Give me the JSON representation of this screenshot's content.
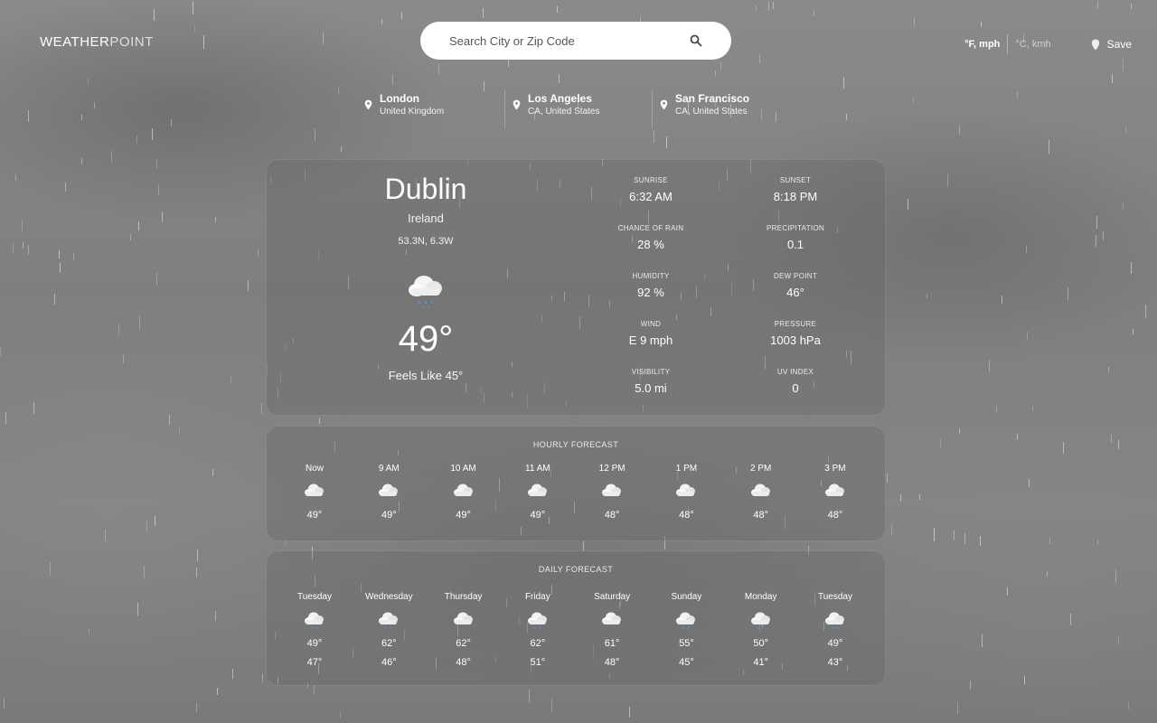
{
  "app": {
    "logo_bold": "WEATHER",
    "logo_light": "POINT"
  },
  "search": {
    "placeholder": "Search City or Zip Code",
    "icon": "search-icon"
  },
  "units": {
    "imperial": "°F, mph",
    "metric": "°C, kmh",
    "selected": "imperial"
  },
  "save_label": "Save",
  "saved_locations": [
    {
      "name": "London",
      "region": "United Kingdom"
    },
    {
      "name": "Los Angeles",
      "region": "CA, United States"
    },
    {
      "name": "San Francisco",
      "region": "CA, United States"
    }
  ],
  "current": {
    "city": "Dublin",
    "country": "Ireland",
    "coords": "53.3N, 6.3W",
    "icon": "cloud-rain-icon",
    "temperature": "49°",
    "feels_like": "Feels Like 45°",
    "stats": [
      {
        "label": "SUNRISE",
        "value": "6:32 AM"
      },
      {
        "label": "SUNSET",
        "value": "8:18 PM"
      },
      {
        "label": "CHANCE OF RAIN",
        "value": "28 %"
      },
      {
        "label": "PRECIPITATION",
        "value": "0.1"
      },
      {
        "label": "HUMIDITY",
        "value": "92 %"
      },
      {
        "label": "DEW POINT",
        "value": "46°"
      },
      {
        "label": "WIND",
        "value": "E 9 mph"
      },
      {
        "label": "PRESSURE",
        "value": "1003 hPa"
      },
      {
        "label": "VISIBILITY",
        "value": "5.0 mi"
      },
      {
        "label": "UV INDEX",
        "value": "0"
      }
    ]
  },
  "hourly": {
    "title": "HOURLY FORECAST",
    "items": [
      {
        "time": "Now",
        "temp": "49°",
        "icon": "cloud-icon"
      },
      {
        "time": "9 AM",
        "temp": "49°",
        "icon": "cloud-icon"
      },
      {
        "time": "10 AM",
        "temp": "49°",
        "icon": "cloud-icon"
      },
      {
        "time": "11 AM",
        "temp": "49°",
        "icon": "cloud-icon"
      },
      {
        "time": "12 PM",
        "temp": "48°",
        "icon": "cloud-icon"
      },
      {
        "time": "1 PM",
        "temp": "48°",
        "icon": "cloud-icon"
      },
      {
        "time": "2 PM",
        "temp": "48°",
        "icon": "cloud-icon"
      },
      {
        "time": "3 PM",
        "temp": "48°",
        "icon": "cloud-icon"
      }
    ]
  },
  "daily": {
    "title": "DAILY FORECAST",
    "items": [
      {
        "day": "Tuesday",
        "high": "49°",
        "low": "47°",
        "icon": "cloud-rain-icon"
      },
      {
        "day": "Wednesday",
        "high": "62°",
        "low": "46°",
        "icon": "cloud-rain-icon"
      },
      {
        "day": "Thursday",
        "high": "62°",
        "low": "48°",
        "icon": "cloud-icon"
      },
      {
        "day": "Friday",
        "high": "62°",
        "low": "51°",
        "icon": "cloud-rain-icon"
      },
      {
        "day": "Saturday",
        "high": "61°",
        "low": "48°",
        "icon": "cloud-icon"
      },
      {
        "day": "Sunday",
        "high": "55°",
        "low": "45°",
        "icon": "cloud-rain-icon"
      },
      {
        "day": "Monday",
        "high": "50°",
        "low": "41°",
        "icon": "cloud-rain-icon"
      },
      {
        "day": "Tuesday",
        "high": "49°",
        "low": "43°",
        "icon": "cloud-rain-icon"
      }
    ]
  }
}
